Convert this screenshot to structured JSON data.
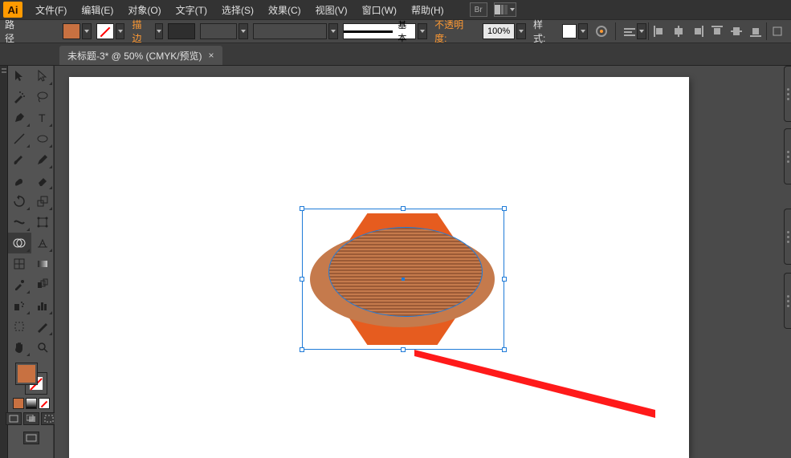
{
  "app": {
    "logo": "Ai"
  },
  "menu": {
    "file": "文件(F)",
    "edit": "编辑(E)",
    "object": "对象(O)",
    "type": "文字(T)",
    "select": "选择(S)",
    "effect": "效果(C)",
    "view": "视图(V)",
    "window": "窗口(W)",
    "help": "帮助(H)"
  },
  "br_label": "Br",
  "control": {
    "selection_type": "路径",
    "stroke_label": "描边",
    "stroke_width": "",
    "style_label": "基本",
    "opacity_label": "不透明度:",
    "opacity_value": "100%",
    "graphic_style_label": "样式:"
  },
  "doc": {
    "tab_title": "未标题-3* @ 50% (CMYK/预览)"
  },
  "colors": {
    "fill": "#c87141",
    "accent": "#e65c1f",
    "selection": "#1f7bd8"
  }
}
